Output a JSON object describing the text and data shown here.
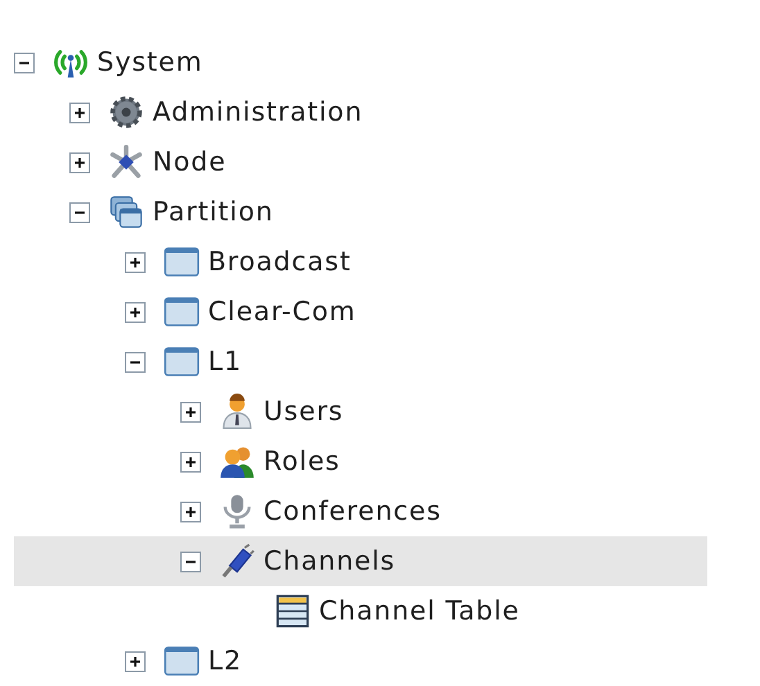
{
  "tree": [
    {
      "label": "System",
      "kind": "antenna",
      "expanded": true,
      "selected": false,
      "children": [
        {
          "label": "Administration",
          "kind": "gear",
          "expanded": false,
          "selected": false
        },
        {
          "label": "Node",
          "kind": "node",
          "expanded": false,
          "selected": false
        },
        {
          "label": "Partition",
          "kind": "partition",
          "expanded": true,
          "selected": false,
          "children": [
            {
              "label": "Broadcast",
              "kind": "window",
              "expanded": false,
              "selected": false
            },
            {
              "label": "Clear-Com",
              "kind": "window",
              "expanded": false,
              "selected": false
            },
            {
              "label": "L1",
              "kind": "window",
              "expanded": true,
              "selected": false,
              "children": [
                {
                  "label": "Users",
                  "kind": "user",
                  "expanded": false,
                  "selected": false
                },
                {
                  "label": "Roles",
                  "kind": "users",
                  "expanded": false,
                  "selected": false
                },
                {
                  "label": "Conferences",
                  "kind": "mic",
                  "expanded": false,
                  "selected": false
                },
                {
                  "label": "Channels",
                  "kind": "plug",
                  "expanded": true,
                  "selected": true,
                  "children": [
                    {
                      "label": "Channel Table",
                      "kind": "table",
                      "selected": false
                    }
                  ]
                }
              ]
            },
            {
              "label": "L2",
              "kind": "window",
              "expanded": false,
              "selected": false
            }
          ]
        }
      ]
    }
  ]
}
